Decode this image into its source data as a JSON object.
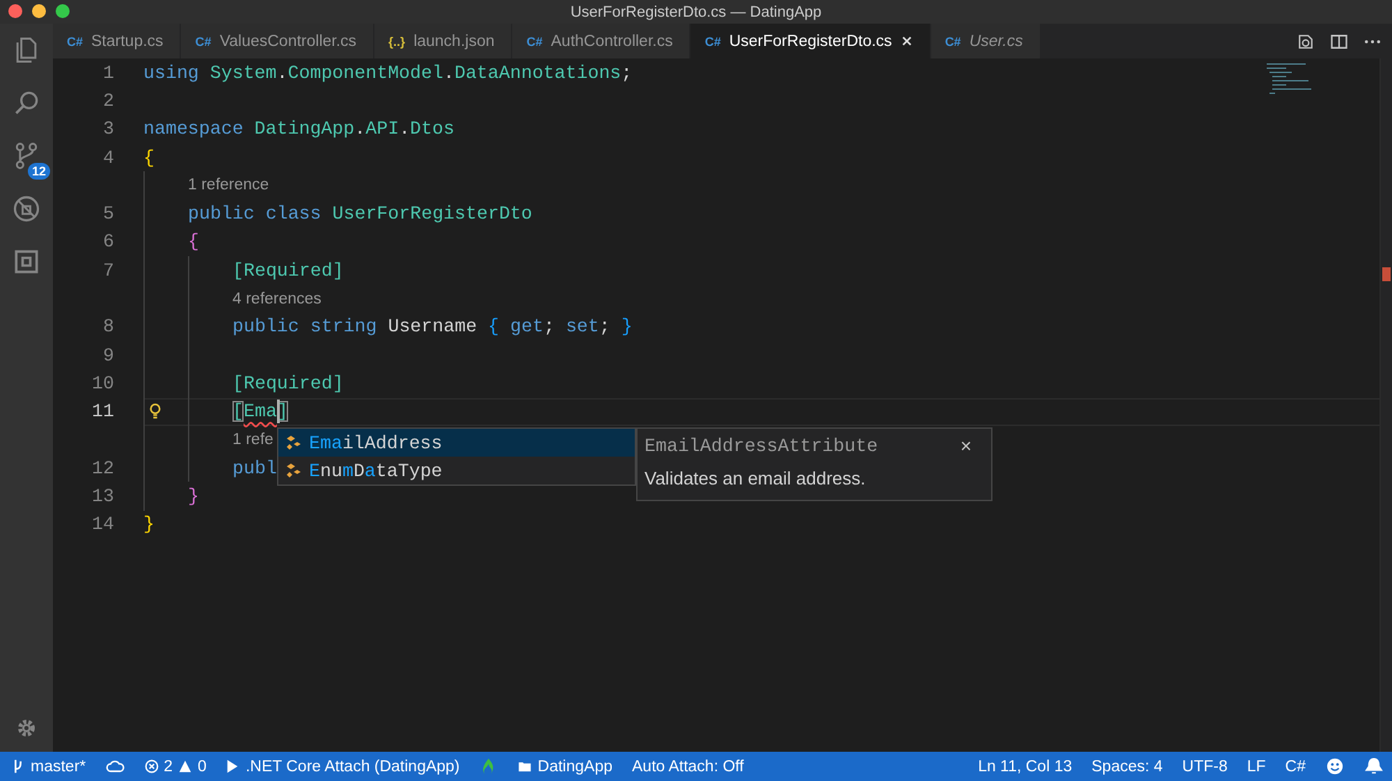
{
  "window": {
    "title": "UserForRegisterDto.cs — DatingApp"
  },
  "activity_bar": {
    "source_control_badge": "12"
  },
  "tabs": [
    {
      "icon": "C#",
      "kind": "cs",
      "label": "Startup.cs",
      "selected": false,
      "preview": false
    },
    {
      "icon": "C#",
      "kind": "cs",
      "label": "ValuesController.cs",
      "selected": false,
      "preview": false
    },
    {
      "icon": "{..}",
      "kind": "json",
      "label": "launch.json",
      "selected": false,
      "preview": false
    },
    {
      "icon": "C#",
      "kind": "cs",
      "label": "AuthController.cs",
      "selected": false,
      "preview": false
    },
    {
      "icon": "C#",
      "kind": "cs",
      "label": "UserForRegisterDto.cs",
      "selected": true,
      "preview": false
    },
    {
      "icon": "C#",
      "kind": "cs",
      "label": "User.cs",
      "selected": false,
      "preview": true
    }
  ],
  "editor": {
    "lines": [
      {
        "kind": "code",
        "number": "1",
        "current": false,
        "lightbulb": false,
        "tokens": [
          {
            "kind": "kw",
            "text": "using "
          },
          {
            "kind": "type",
            "text": "System"
          },
          {
            "kind": "plain",
            "text": "."
          },
          {
            "kind": "type",
            "text": "ComponentModel"
          },
          {
            "kind": "plain",
            "text": "."
          },
          {
            "kind": "type",
            "text": "DataAnnotations"
          },
          {
            "kind": "plain",
            "text": ";"
          }
        ]
      },
      {
        "kind": "code",
        "number": "2",
        "current": false,
        "lightbulb": false
      },
      {
        "kind": "code",
        "number": "3",
        "current": false,
        "lightbulb": false,
        "tokens": [
          {
            "kind": "kw",
            "text": "namespace "
          },
          {
            "kind": "type",
            "text": "DatingApp"
          },
          {
            "kind": "plain",
            "text": "."
          },
          {
            "kind": "type",
            "text": "API"
          },
          {
            "kind": "plain",
            "text": "."
          },
          {
            "kind": "type",
            "text": "Dtos"
          }
        ]
      },
      {
        "kind": "code",
        "number": "4",
        "current": false,
        "lightbulb": false,
        "tokens": [
          {
            "kind": "brace1",
            "text": "{"
          }
        ],
        "children": [
          {
            "kind": "lens",
            "text": "1 reference"
          },
          {
            "kind": "code",
            "number": "5",
            "current": false,
            "lightbulb": false,
            "tokens": [
              {
                "kind": "kw",
                "text": "public "
              },
              {
                "kind": "kw",
                "text": "class "
              },
              {
                "kind": "type",
                "text": "UserForRegisterDto"
              }
            ]
          },
          {
            "kind": "code",
            "number": "6",
            "current": false,
            "lightbulb": false,
            "tokens": [
              {
                "kind": "brace2",
                "text": "{"
              }
            ],
            "children": [
              {
                "kind": "code",
                "number": "7",
                "current": false,
                "lightbulb": false,
                "tokens": [
                  {
                    "kind": "type",
                    "text": "[Required]"
                  }
                ]
              },
              {
                "kind": "lens",
                "text": "4 references"
              },
              {
                "kind": "code",
                "number": "8",
                "current": false,
                "lightbulb": false,
                "tokens": [
                  {
                    "kind": "kw",
                    "text": "public "
                  },
                  {
                    "kind": "kw",
                    "text": "string "
                  },
                  {
                    "kind": "plain",
                    "text": "Username "
                  },
                  {
                    "kind": "brace3",
                    "text": "{ "
                  },
                  {
                    "kind": "kw",
                    "text": "get"
                  },
                  {
                    "kind": "plain",
                    "text": "; "
                  },
                  {
                    "kind": "kw",
                    "text": "set"
                  },
                  {
                    "kind": "plain",
                    "text": "; "
                  },
                  {
                    "kind": "brace3",
                    "text": "}"
                  }
                ]
              },
              {
                "kind": "code",
                "number": "9",
                "current": false,
                "lightbulb": false
              },
              {
                "kind": "code",
                "number": "10",
                "current": false,
                "lightbulb": false,
                "tokens": [
                  {
                    "kind": "type",
                    "text": "[Required]"
                  }
                ]
              },
              {
                "kind": "code",
                "number": "11",
                "current": true,
                "lightbulb": true,
                "tokens": [
                  {
                    "kind": "match",
                    "text": "["
                  },
                  {
                    "kind": "error",
                    "text": "Ema"
                  },
                  {
                    "kind": "caret"
                  },
                  {
                    "kind": "match",
                    "text": "]"
                  }
                ]
              },
              {
                "kind": "lens",
                "text": "1 refe"
              },
              {
                "kind": "code",
                "number": "12",
                "current": false,
                "lightbulb": false,
                "tokens": [
                  {
                    "kind": "kw",
                    "text": "publ"
                  }
                ]
              }
            ]
          },
          {
            "kind": "code",
            "number": "13",
            "current": false,
            "lightbulb": false,
            "tokens": [
              {
                "kind": "brace2",
                "text": "}"
              }
            ]
          }
        ]
      },
      {
        "kind": "code",
        "number": "14",
        "current": false,
        "lightbulb": false,
        "tokens": [
          {
            "kind": "brace1",
            "text": "}"
          }
        ]
      }
    ]
  },
  "suggestions": [
    {
      "selected": true,
      "parts": [
        {
          "text": "Ema",
          "match": true
        },
        {
          "text": "ilAddress",
          "match": false
        }
      ]
    },
    {
      "selected": false,
      "parts": [
        {
          "text": "E",
          "match": true
        },
        {
          "text": "nu",
          "match": false
        },
        {
          "text": "m",
          "match": true
        },
        {
          "text": "D",
          "match": false
        },
        {
          "text": "a",
          "match": true
        },
        {
          "text": "taType",
          "match": false
        }
      ]
    }
  ],
  "suggestion_detail": {
    "title": "EmailAddressAttribute",
    "close": "×",
    "description": "Validates an email address."
  },
  "status_bar": {
    "branch": "master*",
    "errors": "2",
    "warnings": "0",
    "debug": ".NET Core Attach (DatingApp)",
    "folder": "DatingApp",
    "auto_attach": "Auto Attach: Off",
    "position": "Ln 11, Col 13",
    "spaces": "Spaces: 4",
    "encoding": "UTF-8",
    "eol": "LF",
    "language": "C#"
  }
}
